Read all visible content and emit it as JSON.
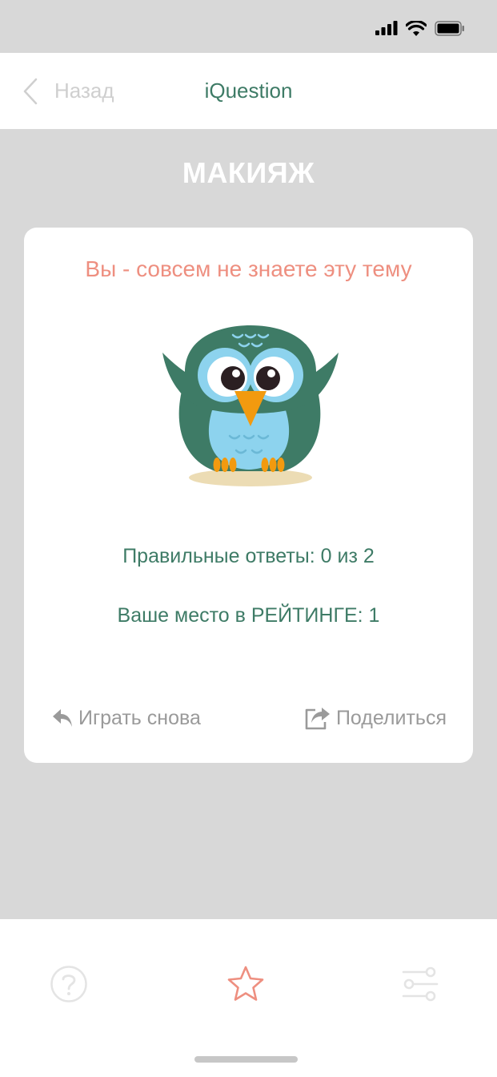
{
  "nav": {
    "back_label": "Назад",
    "title": "iQuestion"
  },
  "topic": {
    "title": "МАКИЯЖ"
  },
  "result": {
    "title": "Вы - совсем не знаете эту тему",
    "correct_answers": "Правильные ответы: 0 из 2",
    "rating_place": "Ваше место в РЕЙТИНГЕ: 1",
    "play_again_label": "Играть снова",
    "share_label": "Поделиться"
  },
  "tabs": [
    {
      "name": "help",
      "icon": "question-circle-icon"
    },
    {
      "name": "rating",
      "icon": "star-icon",
      "active": true
    },
    {
      "name": "settings",
      "icon": "sliders-icon"
    }
  ],
  "colors": {
    "accent": "#3e7b66",
    "result_title": "#ee8f80",
    "background": "#d8d8d8",
    "muted": "#9a9a9a"
  }
}
